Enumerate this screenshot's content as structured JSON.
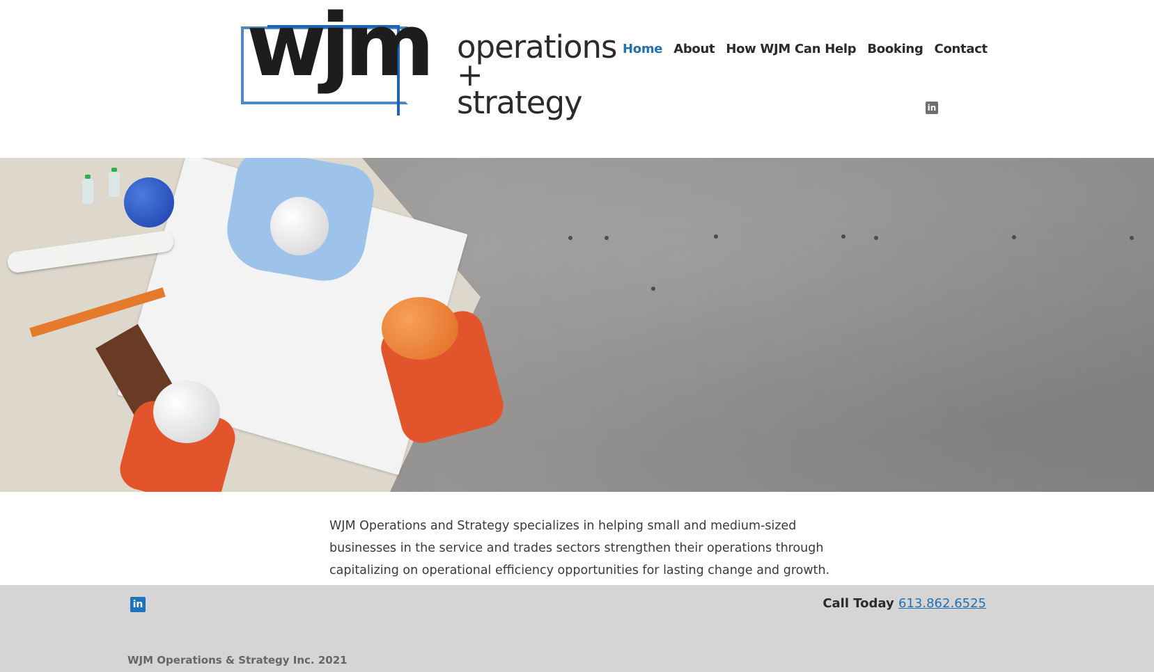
{
  "logo": {
    "mark": "wjm",
    "line1": "operations",
    "line2": "+ strategy"
  },
  "nav": {
    "items": [
      {
        "label": "Home",
        "active": true
      },
      {
        "label": "About",
        "active": false
      },
      {
        "label": "How WJM Can Help",
        "active": false
      },
      {
        "label": "Booking",
        "active": false
      },
      {
        "label": "Contact",
        "active": false
      }
    ]
  },
  "social": {
    "icon": "linkedin-icon",
    "glyph": "in"
  },
  "intro": {
    "text": "WJM Operations and Strategy specializes in helping small and medium-sized businesses in the service and trades sectors strengthen their operations through capitalizing on operational efficiency opportunities for lasting change and growth. Learn more",
    "link": "about"
  },
  "footer": {
    "call_label": "Call Today",
    "phone": "613.862.6525",
    "copyright": "WJM Operations & Strategy Inc. 2021"
  },
  "colors": {
    "accent": "#2271b1",
    "linkedin_footer": "#1e73be",
    "linkedin_header": "#6e6e6e",
    "footer_bg": "#d5d5d5"
  }
}
